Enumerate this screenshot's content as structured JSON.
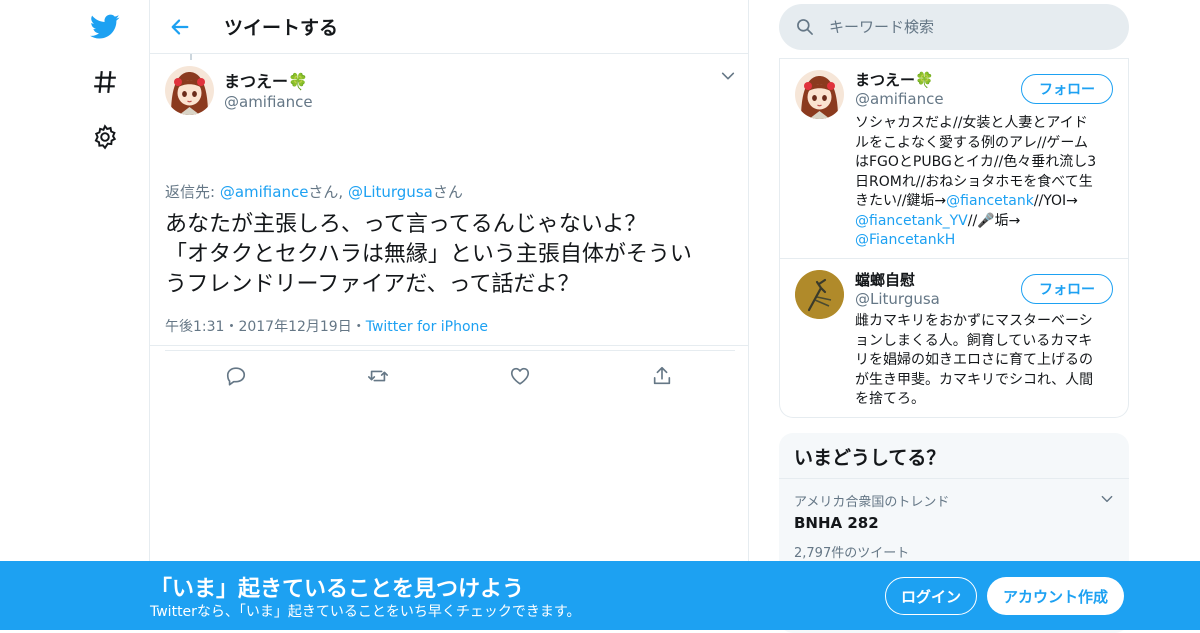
{
  "colors": {
    "accent": "#1da1f2",
    "text": "#14171a",
    "secondary": "#657786",
    "border": "#e6ecf0"
  },
  "nav": {
    "icons": [
      "twitter-bird-icon",
      "hashtag-icon",
      "gear-icon"
    ]
  },
  "header": {
    "title": "ツイートする"
  },
  "tweet": {
    "author_name": "まつえー🍀",
    "author_handle": "@amifiance",
    "reply_prefix": "返信先: ",
    "reply_user1": "@amifiance",
    "reply_sep": "さん, ",
    "reply_user2": "@Liturgusa",
    "reply_suffix": "さん",
    "text_line1": "あなたが主張しろ、って言ってるんじゃないよ？",
    "text_line2": "「オタクとセクハラは無縁」という主張自体がそうい",
    "text_line3": "うフレンドリーファイアだ、って話だよ？",
    "time": "午後1:31",
    "date": "2017年12月19日",
    "separator": "・",
    "source": "Twitter for iPhone"
  },
  "search": {
    "placeholder": "キーワード検索"
  },
  "users": [
    {
      "name": "まつえー🍀",
      "handle": "@amifiance",
      "follow_label": "フォロー",
      "bio_lines": [
        "ソシャカスだよ//女装と人妻とアイド",
        "ルをこよなく愛する例のアレ//ゲーム",
        "はFGOとPUBGとイカ//色々垂れ流し3",
        "日ROMれ//おねショタホモを食べて生"
      ],
      "bio_l5_a": "きたい//鍵垢→",
      "bio_l5_link": "@fiancetank",
      "bio_l5_b": "//YOI→",
      "bio_l6_link": "@fiancetank_YV",
      "bio_l6_b": "//🎤垢→",
      "bio_l7_link": "@FiancetankH"
    },
    {
      "name": "蟷螂自慰",
      "handle": "@Liturgusa",
      "follow_label": "フォロー",
      "bio_lines": [
        "雌カマキリをおかずにマスターベーシ",
        "ョンしまくる人。飼育しているカマキ",
        "リを娼婦の如きエロさに育て上げるの",
        "が生き甲斐。カマキリでシコれ、人間",
        "を捨てろ。"
      ]
    }
  ],
  "trends": {
    "title": "いまどうしてる？",
    "items": [
      {
        "location": "アメリカ合衆国のトレンド",
        "name": "BNHA 282",
        "count": "2,797件のツイート"
      }
    ]
  },
  "banner": {
    "title": "「いま」起きていることを見つけよう",
    "subtitle": "Twitterなら、「いま」起きていることをいち早くチェックできます。",
    "login_label": "ログイン",
    "signup_label": "アカウント作成"
  }
}
